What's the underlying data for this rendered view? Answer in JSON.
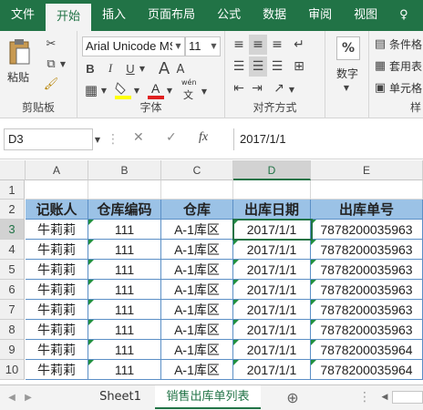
{
  "ribbon_tabs": [
    "文件",
    "开始",
    "插入",
    "页面布局",
    "公式",
    "数据",
    "审阅",
    "视图",
    "♀"
  ],
  "clipboard": {
    "paste_label": "粘贴",
    "group_label": "剪贴板"
  },
  "font": {
    "name": "Arial Unicode MS",
    "size": "11",
    "group_label": "字体",
    "bold": "B",
    "italic": "I",
    "underline": "U",
    "phonetic_top": "wén",
    "phonetic_bottom": "文"
  },
  "alignment": {
    "group_label": "对齐方式"
  },
  "number": {
    "label": "数字",
    "percent": "%"
  },
  "styles": {
    "conditional": "条件格",
    "table": "套用表",
    "cell": "单元格",
    "group_label": "样"
  },
  "formula_bar": {
    "name_box": "D3",
    "fx": "fx",
    "value": "2017/1/1"
  },
  "columns": [
    "A",
    "B",
    "C",
    "D",
    "E"
  ],
  "rows": [
    "1",
    "2",
    "3",
    "4",
    "5",
    "6",
    "7",
    "8",
    "9",
    "10"
  ],
  "table": {
    "headers": [
      "记账人",
      "仓库编码",
      "仓库",
      "出库日期",
      "出库单号"
    ],
    "rows": [
      [
        "牛莉莉",
        "111",
        "A-1库区",
        "2017/1/1",
        "7878200035963"
      ],
      [
        "牛莉莉",
        "111",
        "A-1库区",
        "2017/1/1",
        "7878200035963"
      ],
      [
        "牛莉莉",
        "111",
        "A-1库区",
        "2017/1/1",
        "7878200035963"
      ],
      [
        "牛莉莉",
        "111",
        "A-1库区",
        "2017/1/1",
        "7878200035963"
      ],
      [
        "牛莉莉",
        "111",
        "A-1库区",
        "2017/1/1",
        "7878200035963"
      ],
      [
        "牛莉莉",
        "111",
        "A-1库区",
        "2017/1/1",
        "7878200035963"
      ],
      [
        "牛莉莉",
        "111",
        "A-1库区",
        "2017/1/1",
        "7878200035964"
      ],
      [
        "牛莉莉",
        "111",
        "A-1库区",
        "2017/1/1",
        "7878200035964"
      ]
    ]
  },
  "sheet_tabs": [
    "Sheet1",
    "销售出库单列表"
  ],
  "add_sheet": "⊕",
  "colors": {
    "accent": "#217346",
    "header_fill": "#9bc2e6"
  }
}
